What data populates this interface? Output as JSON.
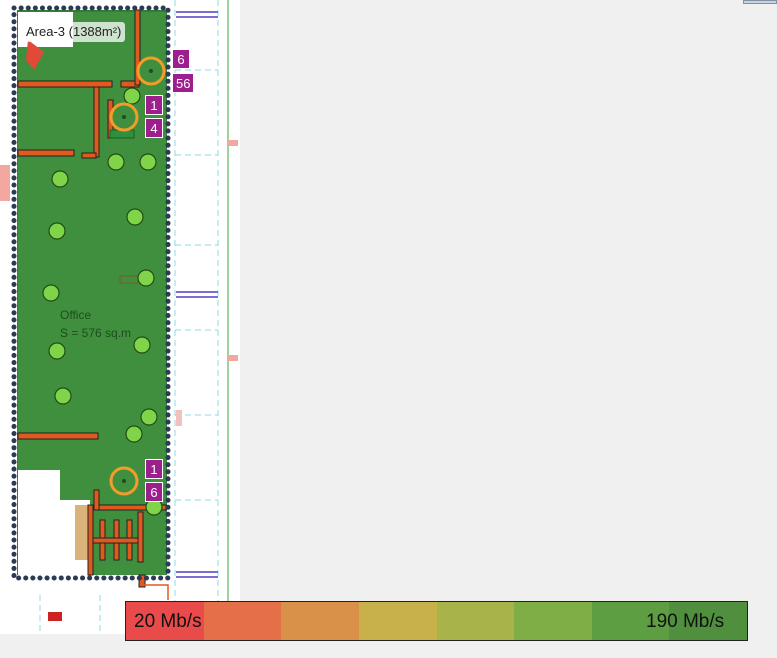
{
  "area": {
    "label": "Area-3 (1388m²)",
    "room_name": "Office",
    "room_area": "S = 576 sq.m",
    "fill_color": "#3f8f3f",
    "wall_color": "#e05a1e"
  },
  "access_points": [
    {
      "id": "ap-top",
      "badges": [
        "6",
        "56"
      ]
    },
    {
      "id": "ap-upper",
      "badges": [
        "1",
        "4"
      ]
    },
    {
      "id": "ap-lower",
      "badges": [
        "1",
        "6"
      ]
    }
  ],
  "legend": {
    "min_label": "20 Mb/s",
    "max_label": "190 Mb/s",
    "colors": [
      "#e94b4b",
      "#e46f49",
      "#d99048",
      "#c8b04a",
      "#a8b44a",
      "#7fae47",
      "#5e9e42",
      "#4f8f3d"
    ]
  },
  "icons": {
    "access_point": "ap-ring-icon",
    "client": "client-dot-icon"
  }
}
